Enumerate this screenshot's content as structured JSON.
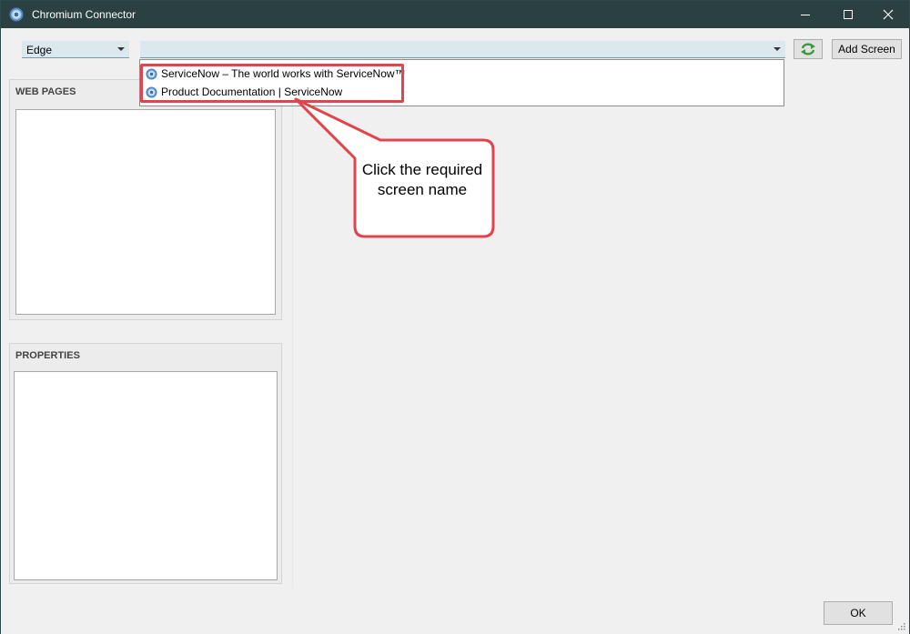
{
  "window": {
    "title": "Chromium Connector",
    "controls": {
      "minimize": "minimize",
      "maximize": "maximize",
      "close": "close"
    }
  },
  "toolbar": {
    "browser_select": {
      "value": "Edge"
    },
    "screen_select": {
      "value": ""
    },
    "refresh_icon": "refresh-icon",
    "add_screen_label": "Add Screen"
  },
  "dropdown": {
    "items": [
      {
        "label": "ServiceNow – The world works with ServiceNow™"
      },
      {
        "label": "Product Documentation | ServiceNow"
      }
    ]
  },
  "panels": {
    "web_pages": {
      "title": "WEB PAGES"
    },
    "properties": {
      "title": "PROPERTIES"
    }
  },
  "callout": {
    "text": "Click the required screen name"
  },
  "footer": {
    "ok_label": "OK"
  },
  "colors": {
    "titlebar": "#2b4141",
    "combo_bg": "#dbe8ee",
    "highlight": "#e0444c",
    "refresh_green": "#3a9a3a"
  }
}
